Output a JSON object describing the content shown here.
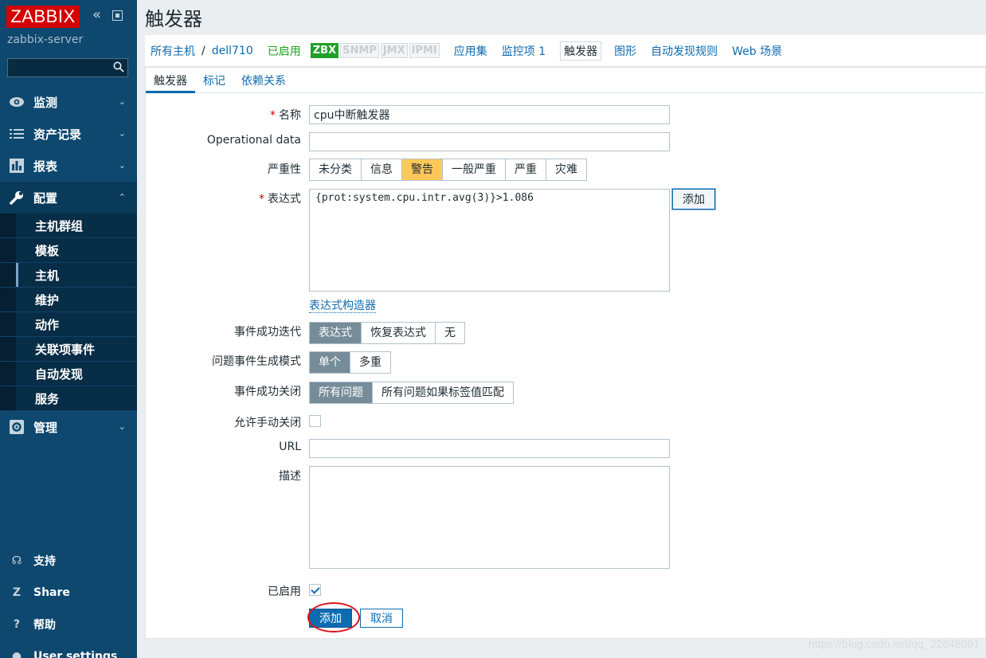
{
  "sidebar": {
    "logo": "ZABBIX",
    "server_name": "zabbix-server",
    "search_placeholder": "",
    "menu": [
      {
        "label": "监测",
        "icon": "eye-icon"
      },
      {
        "label": "资产记录",
        "icon": "list-icon"
      },
      {
        "label": "报表",
        "icon": "bar-chart-icon"
      },
      {
        "label": "配置",
        "icon": "wrench-icon"
      },
      {
        "label": "管理",
        "icon": "gear-icon"
      }
    ],
    "config_sub": [
      "主机群组",
      "模板",
      "主机",
      "维护",
      "动作",
      "关联项事件",
      "自动发现",
      "服务"
    ],
    "bottom": [
      {
        "label": "支持",
        "icon": "headset-icon"
      },
      {
        "label": "Share",
        "icon": "share-icon"
      },
      {
        "label": "帮助",
        "icon": "help-icon"
      },
      {
        "label": "User settings",
        "icon": "user-icon"
      }
    ]
  },
  "header": {
    "title": "触发器"
  },
  "breadcrumb": {
    "all_hosts": "所有主机",
    "separator": "/",
    "host": "dell710",
    "status": "已启用",
    "tags": [
      "ZBX",
      "SNMP",
      "JMX",
      "IPMI"
    ],
    "links": [
      "应用集",
      "监控项 1",
      "触发器",
      "图形",
      "自动发现规则",
      "Web 场景"
    ]
  },
  "tabs": [
    "触发器",
    "标记",
    "依赖关系"
  ],
  "form": {
    "name_label": "名称",
    "name_value": "cpu中断触发器",
    "opdata_label": "Operational data",
    "opdata_value": "",
    "severity_label": "严重性",
    "severity_options": [
      "未分类",
      "信息",
      "警告",
      "一般严重",
      "严重",
      "灾难"
    ],
    "severity_selected": "警告",
    "expression_label": "表达式",
    "expression_value": "{prot:system.cpu.intr.avg(3)}>1.086",
    "add_expr_button": "添加",
    "expr_constructor_link": "表达式构造器",
    "ok_event_label": "事件成功迭代",
    "ok_event_options": [
      "表达式",
      "恢复表达式",
      "无"
    ],
    "problem_mode_label": "问题事件生成模式",
    "problem_mode_options": [
      "单个",
      "多重"
    ],
    "ok_close_label": "事件成功关闭",
    "ok_close_options": [
      "所有问题",
      "所有问题如果标签值匹配"
    ],
    "manual_close_label": "允许手动关闭",
    "manual_close_checked": false,
    "url_label": "URL",
    "url_value": "",
    "desc_label": "描述",
    "desc_value": "",
    "enabled_label": "已启用",
    "enabled_checked": true,
    "submit_button": "添加",
    "cancel_button": "取消"
  },
  "watermark": "https://blog.csdn.net/qq_22648091",
  "colors": {
    "sidebar_bg": "#0e486f",
    "logo_red": "#d40000",
    "link_blue": "#0d6bb0",
    "warning_yellow": "#ffc859",
    "selected_gray": "#768d99",
    "enabled_green": "#1ca51a"
  }
}
